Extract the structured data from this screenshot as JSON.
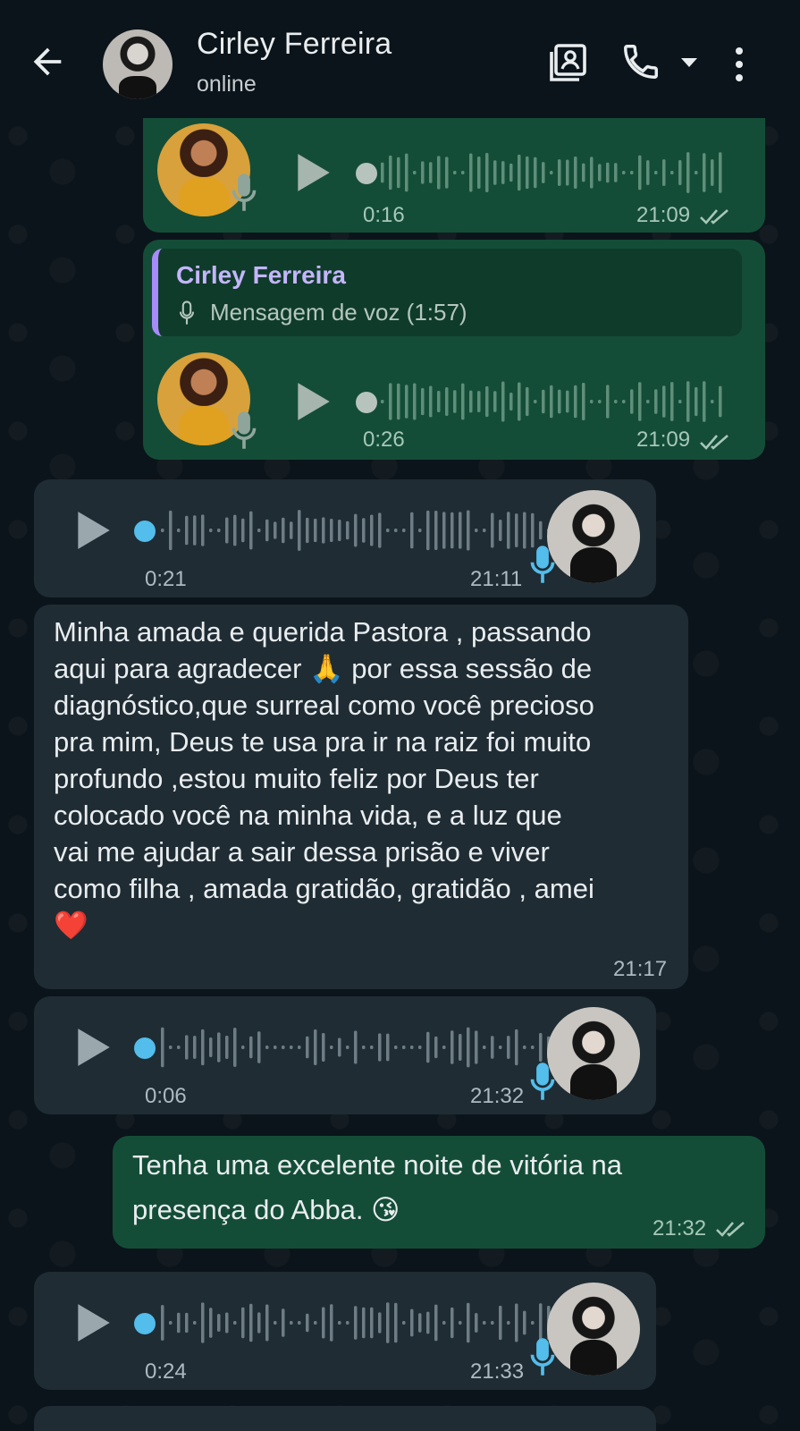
{
  "header": {
    "contact_name": "Cirley Ferreira",
    "status": "online",
    "icons": [
      "arrow-back-icon",
      "contact-card-icon",
      "phone-icon",
      "chevron-down-icon",
      "more-vert-icon"
    ]
  },
  "quote": {
    "author": "Cirley Ferreira",
    "text": "Mensagem de voz (1:57)"
  },
  "messages": [
    {
      "type": "voice",
      "direction": "out",
      "duration": "0:16",
      "time": "21:09",
      "read": true
    },
    {
      "type": "voice",
      "direction": "out",
      "duration": "0:26",
      "time": "21:09",
      "read": true,
      "reply_to": "quote"
    },
    {
      "type": "voice",
      "direction": "in",
      "duration": "0:21",
      "time": "21:11"
    },
    {
      "type": "text",
      "direction": "in",
      "text": "Minha amada e querida Pastora , passando\naqui para agradecer 🙏 por essa sessão de\ndiagnóstico,que surreal como você precioso\npra mim, Deus te usa pra ir na raiz foi muito\nprofundo ,estou muito feliz por Deus ter\ncolocado você na minha vida, e a luz que\nvai me ajudar a sair dessa prisão e viver\ncomo filha , amada gratidão, gratidão , amei\n❤️",
      "time": "21:17"
    },
    {
      "type": "voice",
      "direction": "in",
      "duration": "0:06",
      "time": "21:32"
    },
    {
      "type": "text",
      "direction": "out",
      "text": "Tenha uma excelente noite de vitória na\npresença do Abba. 😘",
      "time": "21:32",
      "read": true
    },
    {
      "type": "voice",
      "direction": "in",
      "duration": "0:24",
      "time": "21:33"
    }
  ],
  "colors": {
    "background": "#0b141a",
    "bubble_out": "#144d37",
    "bubble_in": "#1f2c34",
    "accent_blue": "#53bdeb",
    "quote_bar": "#a78bfa"
  }
}
